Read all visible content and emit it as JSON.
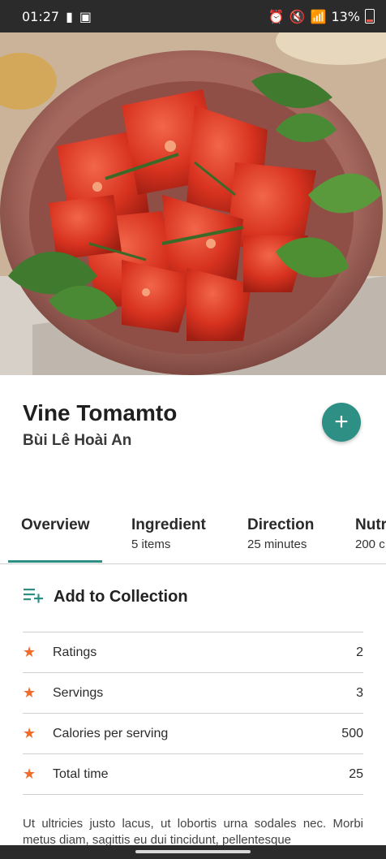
{
  "status_bar": {
    "time": "01:27",
    "battery": "13%"
  },
  "recipe": {
    "title": "Vine Tomamto",
    "author": "Bùi Lê Hoài An"
  },
  "tabs": [
    {
      "label": "Overview",
      "sub": ""
    },
    {
      "label": "Ingredient",
      "sub": "5 items"
    },
    {
      "label": "Direction",
      "sub": "25 minutes"
    },
    {
      "label": "Nutr",
      "sub": "200 c"
    }
  ],
  "collection": {
    "label": "Add to Collection"
  },
  "stats": [
    {
      "label": "Ratings",
      "value": "2"
    },
    {
      "label": "Servings",
      "value": "3"
    },
    {
      "label": "Calories per serving",
      "value": "500"
    },
    {
      "label": "Total time",
      "value": "25"
    }
  ],
  "description": "Ut ultricies justo lacus, ut lobortis urna sodales nec. Morbi metus diam, sagittis eu dui tincidunt, pellentesque",
  "colors": {
    "accent": "#2e8f85",
    "star": "#f26b2b"
  },
  "icons": {
    "fab": "plus-icon",
    "collection": "playlist-add-icon",
    "star": "star-icon"
  }
}
